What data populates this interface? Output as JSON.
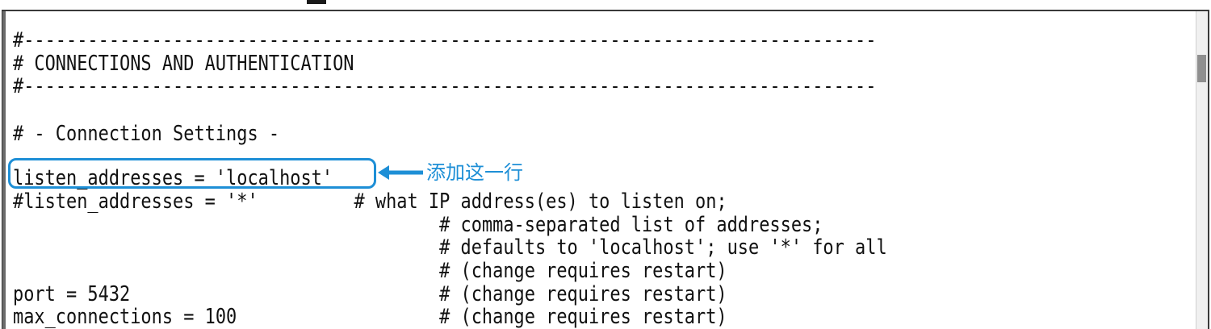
{
  "editor": {
    "lines": [
      "#--------------------------------------------------------------------------------",
      "# CONNECTIONS AND AUTHENTICATION",
      "#--------------------------------------------------------------------------------",
      "",
      "# - Connection Settings -",
      "",
      "listen_addresses = 'localhost'",
      "#listen_addresses = '*'         # what IP address(es) to listen on;",
      "                                        # comma-separated list of addresses;",
      "                                        # defaults to 'localhost'; use '*' for all",
      "                                        # (change requires restart)",
      "port = 5432                             # (change requires restart)",
      "max_connections = 100                   # (change requires restart)"
    ]
  },
  "annotation": {
    "text": "添加这一行",
    "color": "#1e8fd6"
  }
}
